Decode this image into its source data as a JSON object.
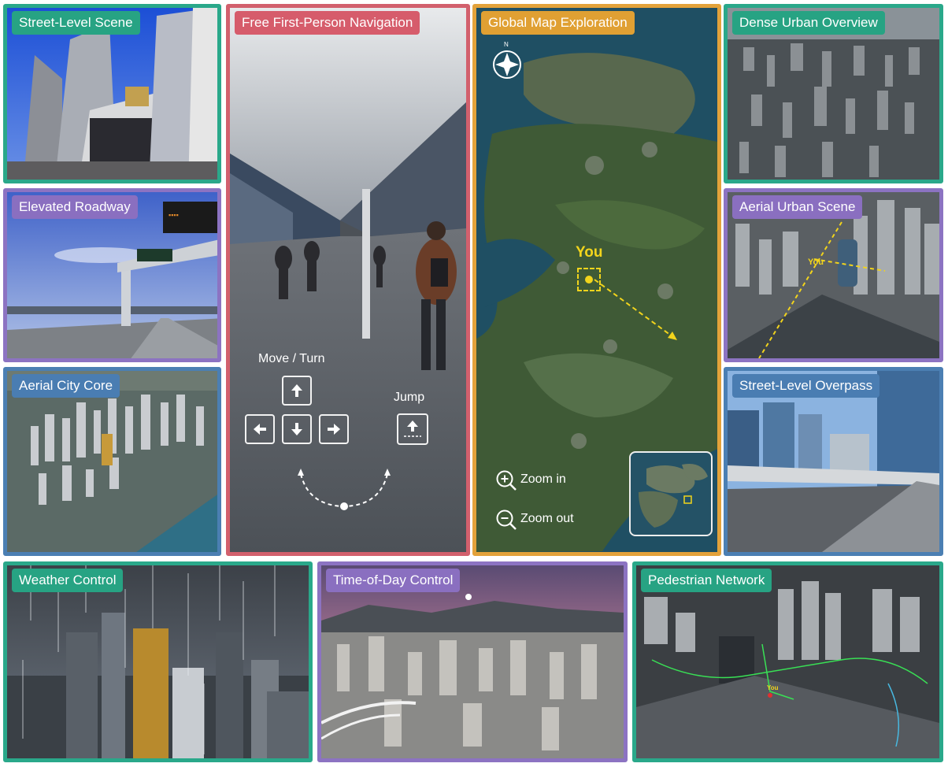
{
  "panels": {
    "street_level_scene": {
      "label": "Street-Level Scene"
    },
    "elevated_roadway": {
      "label": "Elevated Roadway"
    },
    "aerial_city_core": {
      "label": "Aerial City Core"
    },
    "first_person": {
      "label": "Free First-Person Navigation",
      "move_turn_label": "Move / Turn",
      "jump_label": "Jump"
    },
    "global_map": {
      "label": "Global Map Exploration",
      "compass_label": "N",
      "you_label": "You",
      "zoom_in_label": "Zoom in",
      "zoom_out_label": "Zoom out"
    },
    "dense_urban_overview": {
      "label": "Dense Urban Overview"
    },
    "aerial_urban_scene": {
      "label": "Aerial Urban Scene",
      "you_label": "You"
    },
    "street_level_overpass": {
      "label": "Street-Level Overpass"
    },
    "weather_control": {
      "label": "Weather Control"
    },
    "time_of_day_control": {
      "label": "Time-of-Day Control"
    },
    "pedestrian_network": {
      "label": "Pedestrian Network",
      "you_label": "You"
    }
  },
  "colors": {
    "teal": "#27a383",
    "purple": "#8a6fc0",
    "blue": "#4a7db2",
    "red": "#d65c6b",
    "orange": "#e0a033",
    "you_marker": "#f2d41c"
  }
}
